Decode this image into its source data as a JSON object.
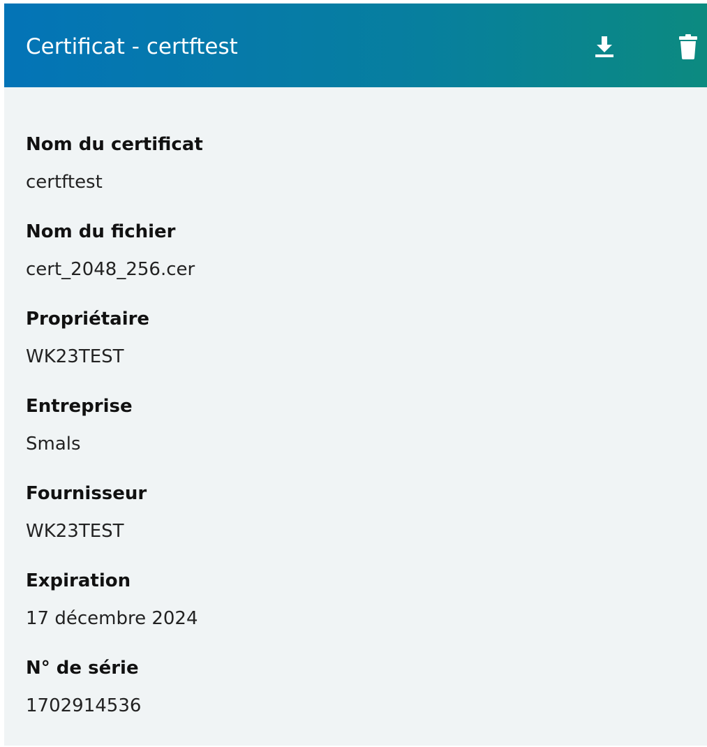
{
  "header": {
    "title": "Certificat - certftest",
    "actions": [
      {
        "icon": "download-icon"
      },
      {
        "icon": "trash-icon"
      }
    ]
  },
  "fields": [
    {
      "label": "Nom du certificat",
      "value": "certftest"
    },
    {
      "label": "Nom du fichier",
      "value": "cert_2048_256.cer"
    },
    {
      "label": "Propriétaire",
      "value": "WK23TEST"
    },
    {
      "label": "Entreprise",
      "value": "Smals"
    },
    {
      "label": "Fournisseur",
      "value": "WK23TEST"
    },
    {
      "label": "Expiration",
      "value": "17 décembre 2024"
    },
    {
      "label": "N° de série",
      "value": "1702914536"
    }
  ],
  "colors": {
    "header_start": "#0474b7",
    "header_end": "#0c8a80",
    "panel_bg": "#f0f4f5"
  }
}
